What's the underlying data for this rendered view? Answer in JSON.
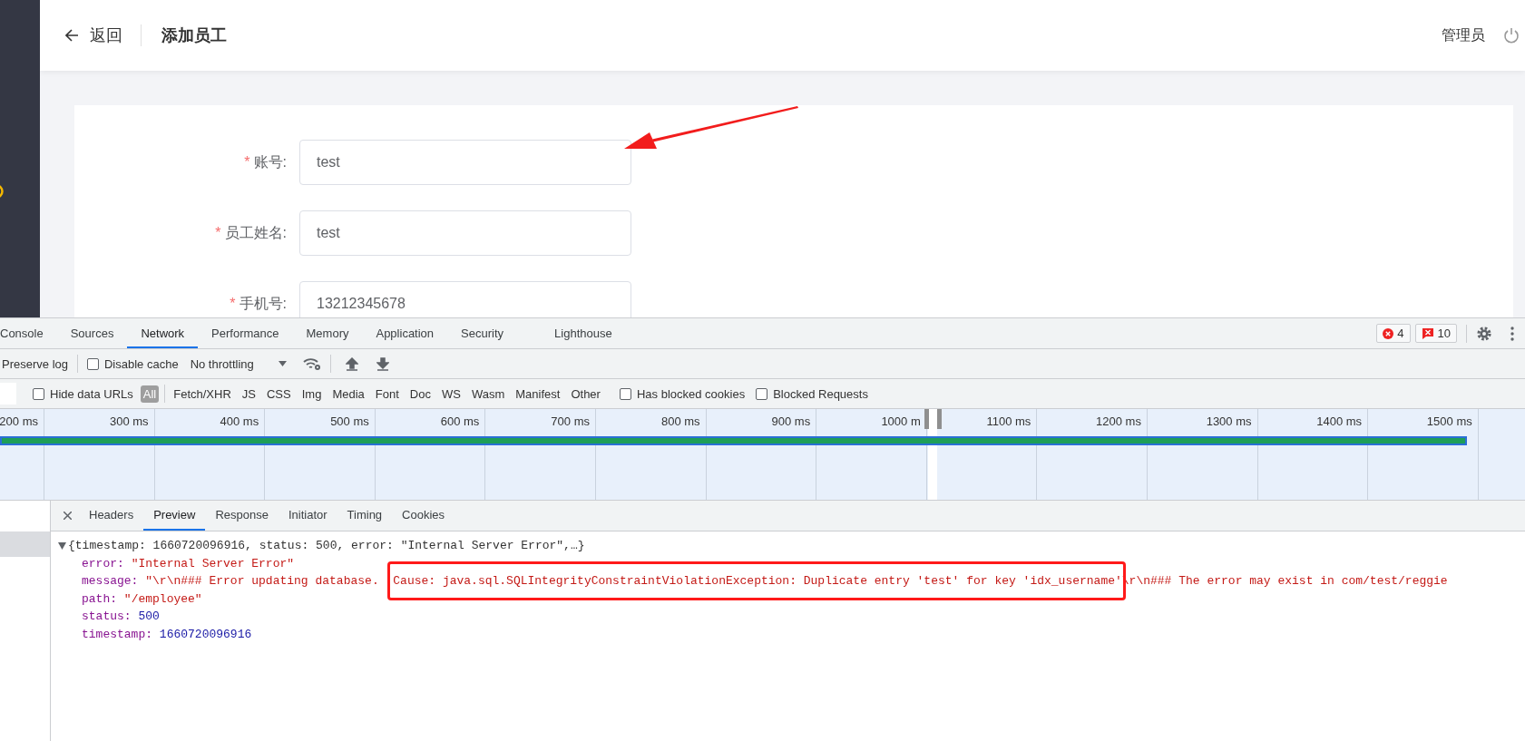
{
  "header": {
    "back": "返回",
    "title": "添加员工",
    "user": "管理员"
  },
  "form": {
    "required_mark": "*",
    "fields": [
      {
        "label": "账号:",
        "required": true,
        "value": "test"
      },
      {
        "label": "员工姓名:",
        "required": true,
        "value": "test"
      },
      {
        "label": "手机号:",
        "required": true,
        "value": "13212345678"
      }
    ]
  },
  "devtools": {
    "tabs": [
      {
        "label": "Console",
        "selected": false
      },
      {
        "label": "Sources",
        "selected": false
      },
      {
        "label": "Network",
        "selected": true
      },
      {
        "label": "Performance",
        "selected": false
      },
      {
        "label": "Memory",
        "selected": false
      },
      {
        "label": "Application",
        "selected": false
      },
      {
        "label": "Security",
        "selected": false
      },
      {
        "label": "Lighthouse",
        "selected": false
      }
    ],
    "error_count": "4",
    "issue_count": "10",
    "toolbar": {
      "preserve_log": "Preserve log",
      "disable_cache": {
        "label": "Disable cache",
        "checked": false
      },
      "throttling": "No throttling"
    },
    "filter": {
      "hide_data_urls": {
        "label": "Hide data URLs",
        "checked": false
      },
      "types": [
        {
          "label": "All",
          "selected": true
        },
        {
          "label": "Fetch/XHR",
          "selected": false
        },
        {
          "label": "JS",
          "selected": false
        },
        {
          "label": "CSS",
          "selected": false
        },
        {
          "label": "Img",
          "selected": false
        },
        {
          "label": "Media",
          "selected": false
        },
        {
          "label": "Font",
          "selected": false
        },
        {
          "label": "Doc",
          "selected": false
        },
        {
          "label": "WS",
          "selected": false
        },
        {
          "label": "Wasm",
          "selected": false
        },
        {
          "label": "Manifest",
          "selected": false
        },
        {
          "label": "Other",
          "selected": false
        }
      ],
      "options": [
        {
          "label": "Has blocked cookies",
          "checked": false
        },
        {
          "label": "Blocked Requests",
          "checked": false
        }
      ]
    },
    "timeline": {
      "ticks": [
        "200 ms",
        "300 ms",
        "400 ms",
        "500 ms",
        "600 ms",
        "700 ms",
        "800 ms",
        "900 ms",
        "1000 m",
        "1100 ms",
        "1200 ms",
        "1300 ms",
        "1400 ms",
        "1500 ms"
      ]
    },
    "details": {
      "tabs": [
        {
          "label": "Headers",
          "selected": false
        },
        {
          "label": "Preview",
          "selected": true
        },
        {
          "label": "Response",
          "selected": false
        },
        {
          "label": "Initiator",
          "selected": false
        },
        {
          "label": "Timing",
          "selected": false
        },
        {
          "label": "Cookies",
          "selected": false
        }
      ],
      "preview": {
        "summary": "{timestamp: 1660720096916, status: 500, error: \"Internal Server Error\",…}",
        "expanded": true,
        "properties": [
          {
            "key": "error:",
            "kind": "string",
            "parts": [
              {
                "text": "\"Internal Server Error\"",
                "annotated": false
              }
            ]
          },
          {
            "key": "message:",
            "kind": "string",
            "parts": [
              {
                "text": "\"\\r\\n### Error updating database.  ",
                "annotated": false
              },
              {
                "text": "Cause: java.sql.SQLIntegrityConstraintViolationException: Duplicate entry 'test' for key 'idx_username'",
                "annotated": true
              },
              {
                "text": "\\r\\n### The error may exist in com/test/reggie",
                "annotated": false
              }
            ]
          },
          {
            "key": "path:",
            "kind": "string",
            "parts": [
              {
                "text": "\"/employee\"",
                "annotated": false
              }
            ]
          },
          {
            "key": "status:",
            "kind": "number",
            "parts": [
              {
                "text": "500",
                "annotated": false
              }
            ]
          },
          {
            "key": "timestamp:",
            "kind": "number",
            "parts": [
              {
                "text": "1660720096916",
                "annotated": false
              }
            ]
          }
        ]
      }
    }
  }
}
